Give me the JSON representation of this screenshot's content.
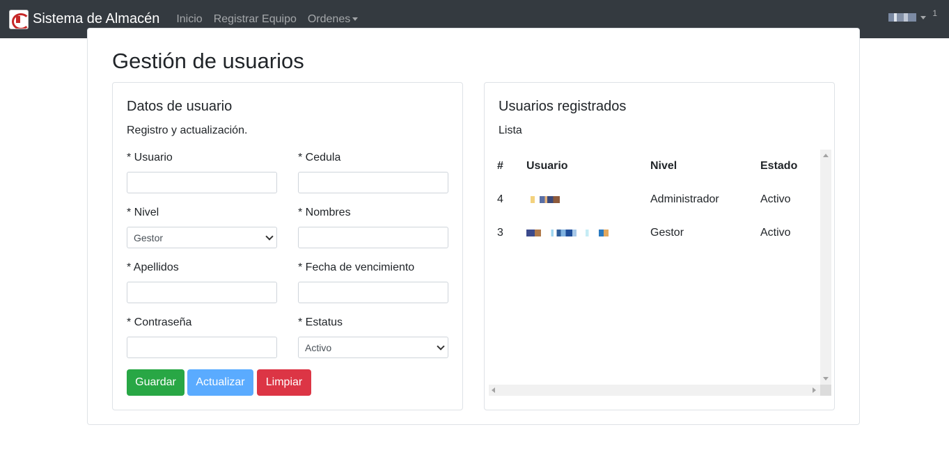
{
  "navbar": {
    "brand": "Sistema de Almacén",
    "links": [
      "Inicio",
      "Registrar Equipo",
      "Ordenes"
    ],
    "badge": "1"
  },
  "page": {
    "title": "Gestión de usuarios"
  },
  "form_card": {
    "title": "Datos de usuario",
    "subtitle": "Registro y actualización.",
    "fields": {
      "usuario": {
        "label": "* Usuario",
        "value": ""
      },
      "cedula": {
        "label": "* Cedula",
        "value": ""
      },
      "nivel": {
        "label": "* Nivel",
        "selected": "Gestor"
      },
      "nombres": {
        "label": "* Nombres",
        "value": ""
      },
      "apellidos": {
        "label": "* Apellidos",
        "value": ""
      },
      "fecha": {
        "label": "* Fecha de vencimiento",
        "value": ""
      },
      "contrasena": {
        "label": "* Contraseña",
        "value": ""
      },
      "estatus": {
        "label": "* Estatus",
        "selected": "Activo"
      }
    },
    "buttons": {
      "save": "Guardar",
      "update": "Actualizar",
      "clear": "Limpiar"
    },
    "colors": {
      "save": "#28a745",
      "update": "#5aabff",
      "clear": "#dc3545"
    }
  },
  "list_card": {
    "title": "Usuarios registrados",
    "subtitle": "Lista",
    "headers": [
      "#",
      "Usuario",
      "Nivel",
      "Estado"
    ],
    "rows": [
      {
        "id": "4",
        "nivel": "Administrador",
        "estado": "Activo"
      },
      {
        "id": "3",
        "nivel": "Gestor",
        "estado": "Activo"
      }
    ]
  }
}
